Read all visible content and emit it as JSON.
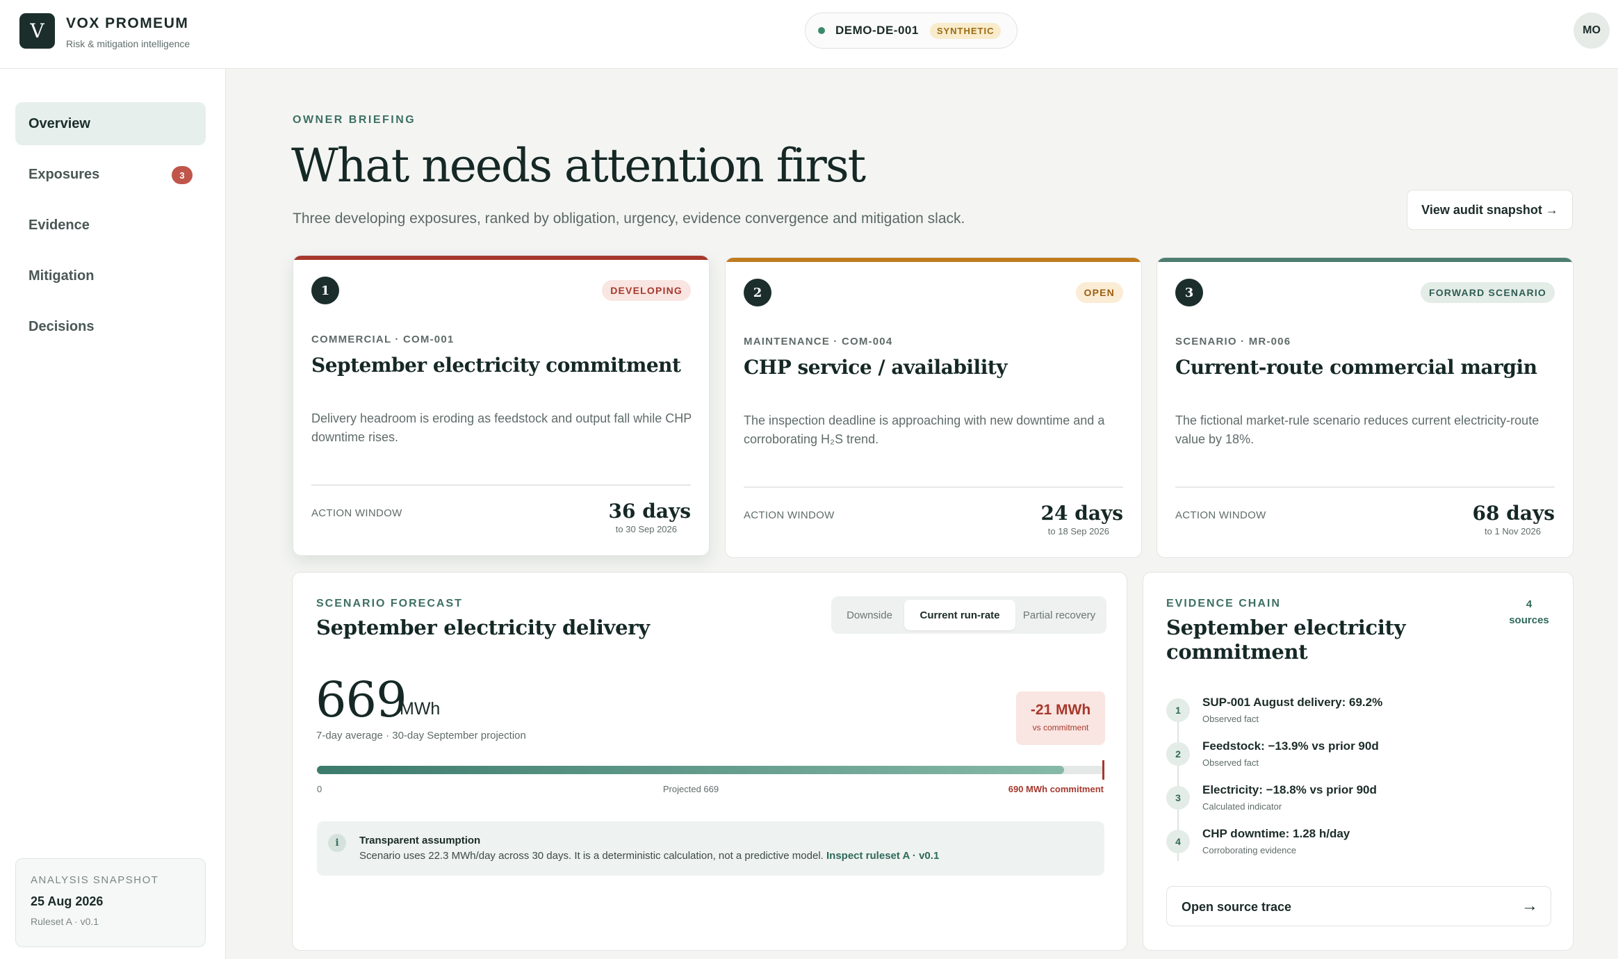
{
  "app": {
    "logo_letter": "V",
    "name": "VOX PROMEUM",
    "tagline": "Risk & mitigation intelligence",
    "environment": "DEMO-DE-001",
    "environment_badge": "SYNTHETIC",
    "user_initials": "MO"
  },
  "sidebar": {
    "items": [
      {
        "label": "Overview",
        "active": true
      },
      {
        "label": "Exposures",
        "badge": "3"
      },
      {
        "label": "Evidence"
      },
      {
        "label": "Mitigation"
      },
      {
        "label": "Decisions"
      }
    ],
    "snapshot": {
      "label": "ANALYSIS SNAPSHOT",
      "date": "25 Aug 2026",
      "ruleset": "Ruleset A · v0.1"
    }
  },
  "main": {
    "eyebrow": "OWNER BRIEFING",
    "title": "What needs attention first",
    "subtitle": "Three developing exposures, ranked by obligation, urgency, evidence convergence and mitigation slack.",
    "audit_button": "View audit snapshot →"
  },
  "cards": [
    {
      "rank": "1",
      "status": "DEVELOPING",
      "code": "COMMERCIAL · COM-001",
      "title": "September electricity commitment",
      "description": "Delivery headroom is eroding as feedstock and output fall while CHP downtime rises.",
      "action_label": "ACTION WINDOW",
      "days": "36 days",
      "deadline": "to 30 Sep 2026",
      "accent": "#a6382d",
      "badge_bg": "#f9e5e1",
      "badge_fg": "#a6382d"
    },
    {
      "rank": "2",
      "status": "OPEN",
      "code": "MAINTENANCE · COM-004",
      "title": "CHP service / availability",
      "description": "The inspection deadline is approaching with new downtime and a corroborating H₂S trend.",
      "action_label": "ACTION WINDOW",
      "days": "24 days",
      "deadline": "to 18 Sep 2026",
      "accent": "#c07a1e",
      "badge_bg": "#fbecd5",
      "badge_fg": "#9a5f12"
    },
    {
      "rank": "3",
      "status": "FORWARD SCENARIO",
      "code": "SCENARIO · MR-006",
      "title": "Current-route commercial margin",
      "description": "The fictional market-rule scenario reduces current electricity-route value by 18%.",
      "action_label": "ACTION WINDOW",
      "days": "68 days",
      "deadline": "to 1 Nov 2026",
      "accent": "#4e7d70",
      "badge_bg": "#e4ece8",
      "badge_fg": "#2e5e52"
    }
  ],
  "forecast": {
    "eyebrow": "SCENARIO FORECAST",
    "title": "September electricity delivery",
    "scenarios": [
      {
        "label": "Downside",
        "active": false
      },
      {
        "label": "Current run-rate",
        "active": true
      },
      {
        "label": "Partial recovery",
        "active": false
      }
    ],
    "value": "669",
    "unit": "MWh",
    "caption": "7-day average · 30-day September projection",
    "delta": "-21 MWh",
    "delta_caption": "vs commitment",
    "projected": 669,
    "commitment": 690,
    "bar_zero_label": "0",
    "bar_projected_label": "Projected 669",
    "bar_commitment_label": "690 MWh commitment",
    "assumption_title": "Transparent assumption",
    "assumption_body": "Scenario uses 22.3 MWh/day across 30 days. It is a deterministic calculation, not a predictive model.",
    "assumption_link": "Inspect ruleset A · v0.1"
  },
  "evidence": {
    "eyebrow": "EVIDENCE CHAIN",
    "title": "September electricity commitment",
    "count": "4",
    "count_label": "sources",
    "items": [
      {
        "num": "1",
        "text": "SUP-001 August delivery: 69.2%",
        "kind": "Observed fact"
      },
      {
        "num": "2",
        "text": "Feedstock: −13.9% vs prior 90d",
        "kind": "Observed fact"
      },
      {
        "num": "3",
        "text": "Electricity: −18.8% vs prior 90d",
        "kind": "Calculated indicator"
      },
      {
        "num": "4",
        "text": "CHP downtime: 1.28 h/day",
        "kind": "Corroborating evidence"
      }
    ],
    "trace_button": "Open source trace",
    "trace_arrow": "→"
  }
}
